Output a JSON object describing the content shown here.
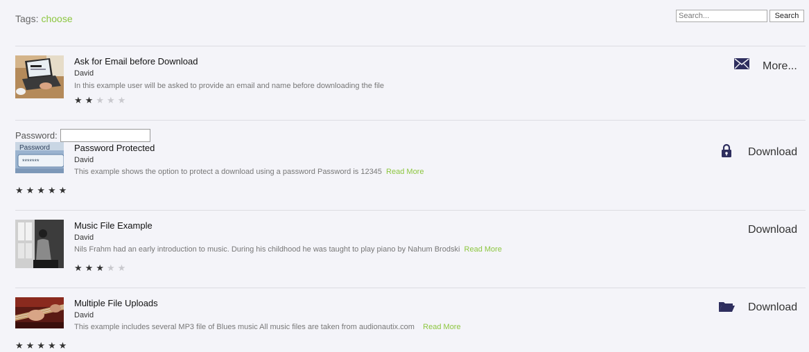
{
  "header": {
    "tags_label": "Tags:",
    "tags_choose": "choose",
    "search_placeholder": "Search...",
    "search_button": "Search"
  },
  "items": [
    {
      "title": "Ask for Email before Download",
      "author": "David",
      "description": "In this example user will be asked to provide an email and name before downloading the file",
      "read_more": "",
      "rating": 2,
      "rating_max": 5,
      "action_icon": "envelope-icon",
      "action_label": "More..."
    },
    {
      "title": "Password Protected",
      "author": "David",
      "description": "This example shows the option to protect a download using a password   Password is 12345",
      "read_more": "Read More",
      "rating": 5,
      "rating_max": 5,
      "action_icon": "lock-icon",
      "action_label": "Download",
      "password_label": "Password:",
      "password_value": ""
    },
    {
      "title": "Music File Example",
      "author": "David",
      "description": "Nils Frahm had an early introduction to music. During his childhood he was taught to play piano by Nahum Brodski",
      "read_more": "Read More",
      "rating": 3,
      "rating_max": 5,
      "action_icon": "",
      "action_label": "Download"
    },
    {
      "title": "Multiple File Uploads",
      "author": "David",
      "description": "This example includes several MP3 file of Blues music All music files are taken from audionautix.com",
      "read_more": "Read More",
      "rating": 5,
      "rating_max": 5,
      "action_icon": "folder-open-icon",
      "action_label": "Download"
    }
  ],
  "colors": {
    "accent": "#8cc63f",
    "icon": "#2e2e5e",
    "background": "#f4f4f9"
  }
}
